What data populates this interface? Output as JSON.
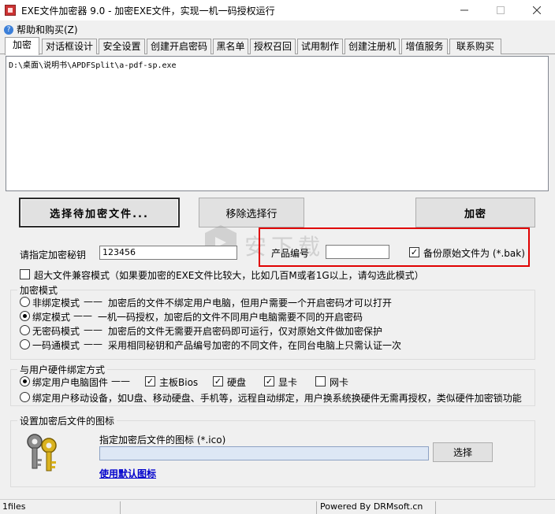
{
  "window": {
    "title": "EXE文件加密器 9.0 - 加密EXE文件，实现一机一码授权运行"
  },
  "menu": {
    "help": "帮助和购买(Z)"
  },
  "tabs": [
    {
      "label": "加密"
    },
    {
      "label": "对话框设计"
    },
    {
      "label": "安全设置"
    },
    {
      "label": "创建开启密码"
    },
    {
      "label": "黑名单"
    },
    {
      "label": "授权召回"
    },
    {
      "label": "试用制作"
    },
    {
      "label": "创建注册机"
    },
    {
      "label": "增值服务"
    },
    {
      "label": "联系购买"
    }
  ],
  "filelist": {
    "items": [
      "D:\\桌面\\说明书\\APDFSplit\\a-pdf-sp.exe"
    ]
  },
  "actions": {
    "select_file": "选择待加密文件...",
    "remove_selected": "移除选择行",
    "encrypt": "加密"
  },
  "key": {
    "label": "请指定加密秘钥",
    "value": "123456",
    "product_code_label": "产品编号",
    "product_code_value": "",
    "backup_label": "备份原始文件为 (*.bak)",
    "backup_checked": true
  },
  "large_file": {
    "label": "超大文件兼容模式（如果要加密的EXE文件比较大，比如几百M或者1G以上，请勾选此模式）",
    "checked": false
  },
  "encrypt_mode": {
    "title": "加密模式",
    "options": [
      {
        "name": "非绑定模式",
        "desc": "加密后的文件不绑定用户电脑，但用户需要一个开启密码才可以打开",
        "selected": false
      },
      {
        "name": "绑定模式",
        "desc": "一机一码授权，加密后的文件不同用户电脑需要不同的开启密码",
        "selected": true
      },
      {
        "name": "无密码模式",
        "desc": "加密后的文件无需要开启密码即可运行，仅对原始文件做加密保护",
        "selected": false
      },
      {
        "name": "一码通模式",
        "desc": "采用相同秘钥和产品编号加密的不同文件，在同台电脑上只需认证一次",
        "selected": false
      }
    ]
  },
  "hardware": {
    "title": "与用户硬件绑定方式",
    "firmware_label": "绑定用户电脑固件",
    "options": [
      {
        "label": "主板Bios",
        "checked": true
      },
      {
        "label": "硬盘",
        "checked": true
      },
      {
        "label": "显卡",
        "checked": true
      },
      {
        "label": "网卡",
        "checked": false
      }
    ],
    "mobile_label": "绑定用户移动设备，如U盘、移动硬盘、手机等，远程自动绑定，用户换系统换硬件无需再授权，类似硬件加密锁功能"
  },
  "icon_settings": {
    "title": "设置加密后文件的图标",
    "prompt": "指定加密后文件的图标 (*.ico)",
    "path_value": "",
    "browse": "选择",
    "use_default": "使用默认图标"
  },
  "status": {
    "files": "1files",
    "powered": "Powered By DRMsoft.cn"
  },
  "colors": {
    "highlight_box": "#e00000",
    "link": "#0000cc"
  }
}
